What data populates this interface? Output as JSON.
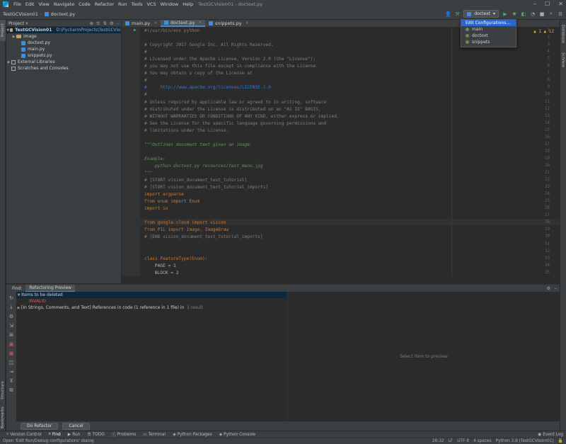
{
  "menubar": {
    "items": [
      "File",
      "Edit",
      "View",
      "Navigate",
      "Code",
      "Refactor",
      "Run",
      "Tools",
      "VCS",
      "Window",
      "Help"
    ],
    "title": "TestGCVision01 - doctext.py"
  },
  "navbar": {
    "project": "TestGCVision01",
    "file": "doctext.py"
  },
  "runbar": {
    "config": "doctext"
  },
  "project_panel": {
    "title": "Project",
    "root": "TestGCVision01",
    "root_path": "D:\\PycharmProjects\\TestGCVisi",
    "items": [
      "image",
      "doctext.py",
      "main.py",
      "snippets.py"
    ],
    "external": "External Libraries",
    "scratches": "Scratches and Consoles"
  },
  "left_stripe": {
    "project": "Project",
    "structure": "Structure",
    "bookmarks": "Bookmarks"
  },
  "right_stripe": {
    "database": "Database",
    "sciview": "SciView"
  },
  "editor_tabs": [
    {
      "label": "main.py",
      "active": false
    },
    {
      "label": "doctext.py",
      "active": true
    },
    {
      "label": "snippets.py",
      "active": false
    }
  ],
  "editor": {
    "warnings": "▲ 1  ▲ 12",
    "line_numbers": [
      "1",
      "2",
      "3",
      "4",
      "5",
      "6",
      "7",
      "8",
      "9",
      "10",
      "11",
      "12",
      "13",
      "14",
      "15",
      "16",
      "17",
      "18",
      "19",
      "20",
      "21",
      "22",
      "23",
      "24",
      "25",
      "26",
      "27",
      "28",
      "29",
      "30",
      "31",
      "32",
      "33",
      "34",
      "35"
    ],
    "lines": [
      "#!/usr/bin/env python",
      "",
      "# Copyright 2017 Google Inc. All Rights Reserved.",
      "#",
      "# Licensed under the Apache License, Version 2.0 (the \"License\");",
      "# you may not use this file except in compliance with the License.",
      "# You may obtain a copy of the License at",
      "#",
      "#     http://www.apache.org/licenses/LICENSE-2.0",
      "#",
      "# Unless required by applicable law or agreed to in writing, software",
      "# distributed under the License is distributed on an \"AS IS\" BASIS,",
      "# WITHOUT WARRANTIES OR CONDITIONS OF ANY KIND, either express or implied.",
      "# See the License for the specific language governing permissions and",
      "# limitations under the License.",
      "",
      "\"\"\"Outlines document text given an image.",
      "",
      "Example:",
      "    python doctext.py resources/text_menu.jpg",
      "\"\"\"",
      "# [START vision_document_text_tutorial]",
      "# [START vision_document_text_tutorial_imports]",
      "import argparse",
      "from enum import Enum",
      "import io",
      "",
      "from google.cloud import vision",
      "from PIL import Image, ImageDraw",
      "# [END vision_document_text_tutorial_imports]",
      "",
      "",
      "class FeatureType(Enum):",
      "    PAGE = 1",
      "    BLOCK = 2"
    ]
  },
  "dropdown": {
    "items": [
      "Edit Configurations...",
      "main",
      "doctext",
      "snippets"
    ]
  },
  "bottom": {
    "tabs": [
      "Find:",
      "Refactoring Preview"
    ],
    "tree": {
      "header": "Items to be deleted",
      "invalid": "INVALID",
      "refs": "[In Strings, Comments, and Text] References in code  (1 reference in 1 file) in",
      "refs_count": "1 result"
    },
    "preview_hint": "Select item to preview",
    "do_refactor": "Do Refactor",
    "cancel": "Cancel"
  },
  "toolwindows": [
    "Version Control",
    "Find",
    "Run",
    "TODO",
    "Problems",
    "Terminal",
    "Python Packages",
    "Python Console"
  ],
  "event_log": "Event Log",
  "status": {
    "message": "Open 'Edit Run/Debug configurations' dialog",
    "position": "28:32",
    "line_sep": "LF",
    "encoding": "UTF-8",
    "indent": "4 spaces",
    "interpreter": "Python 3.8 (TestGCVision01)"
  },
  "colors": {
    "background": "#2b2b2b",
    "panel": "#3c3f41",
    "selection": "#0d293e",
    "accent": "#4a88c7",
    "invalid": "#e05555"
  }
}
